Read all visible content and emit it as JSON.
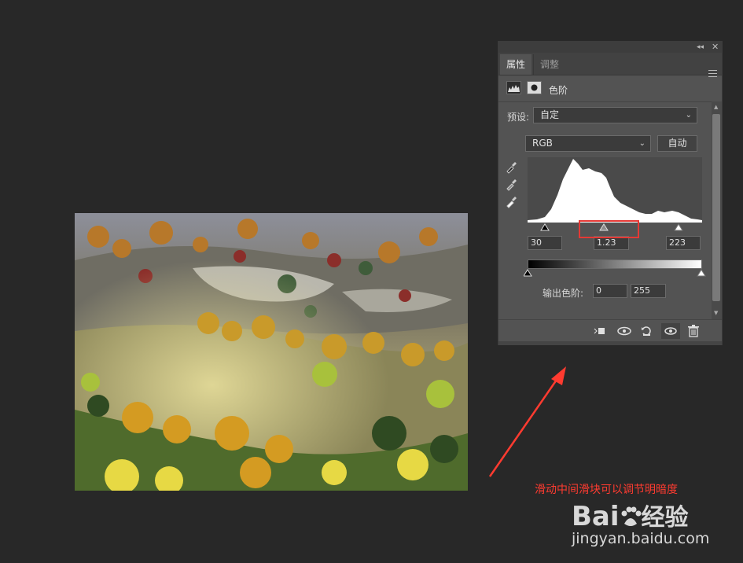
{
  "panel": {
    "tabs": [
      "属性",
      "调整"
    ],
    "adjustment_title": "色阶",
    "preset_label": "预设:",
    "preset_value": "自定",
    "channel_value": "RGB",
    "auto_label": "自动",
    "input_levels": {
      "black": "30",
      "mid": "1.23",
      "white": "223"
    },
    "output_label": "输出色阶:",
    "output_levels": {
      "black": "0",
      "white": "255"
    }
  },
  "annotation": {
    "text": "滑动中间滑块可以调节明暗度",
    "color": "#ff3b30"
  },
  "watermark": {
    "brand": "Bai",
    "suffix": "经验",
    "url": "jingyan.baidu.com"
  },
  "icons": [
    "collapse-icon",
    "close-icon",
    "panel-menu-icon",
    "levels-icon",
    "mask-icon",
    "black-eyedropper-icon",
    "gray-eyedropper-icon",
    "white-eyedropper-icon",
    "clip-to-layer-icon",
    "view-previous-icon",
    "reset-icon",
    "visibility-icon",
    "trash-icon"
  ]
}
